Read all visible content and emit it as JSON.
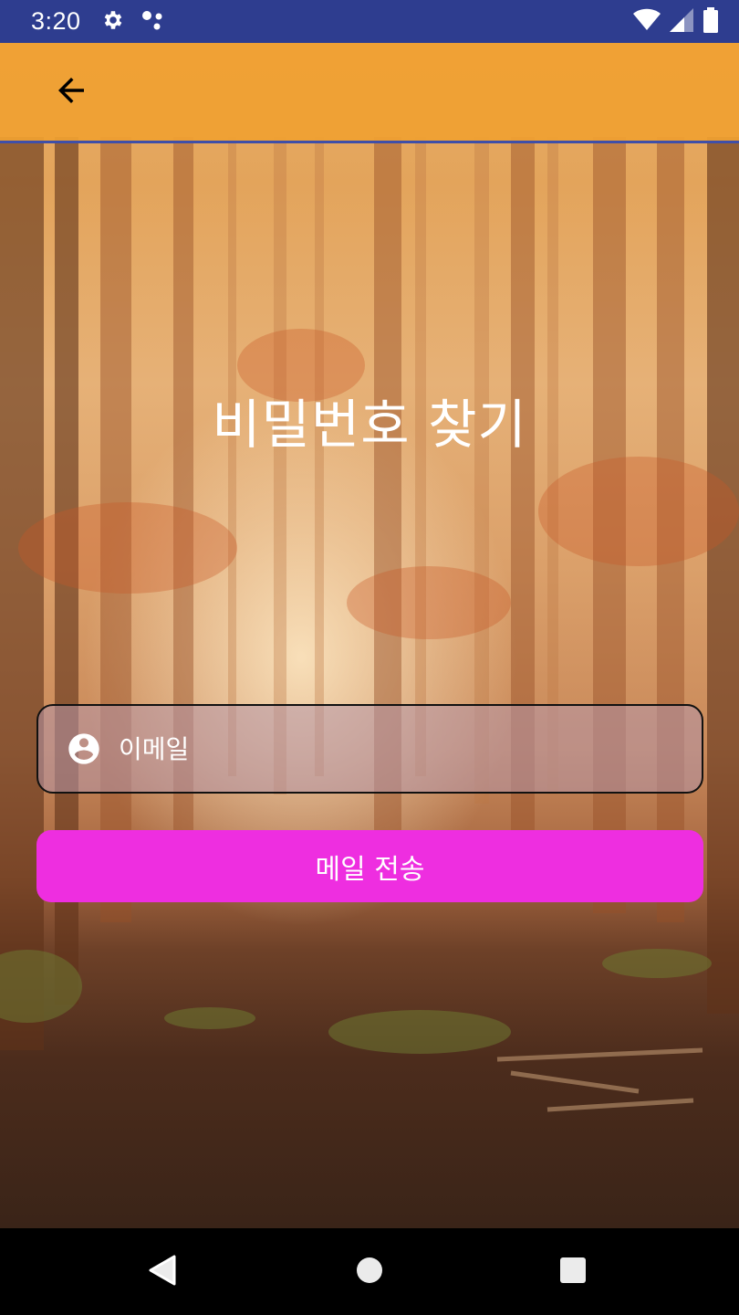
{
  "status_bar": {
    "time": "3:20",
    "icons": [
      "settings-icon",
      "assistant-dots-icon",
      "wifi-icon",
      "signal-icon",
      "battery-icon"
    ]
  },
  "app_bar": {
    "back_icon": "arrow-back-icon",
    "color": "#f0a032"
  },
  "main": {
    "title": "비밀번호 찾기",
    "email_field": {
      "icon": "account-circle-icon",
      "placeholder": "이메일",
      "value": ""
    },
    "send_button": {
      "label": "메일 전송",
      "color": "#ee2ee0"
    }
  },
  "nav_bar": {
    "buttons": [
      "back-triangle-icon",
      "home-circle-icon",
      "recents-square-icon"
    ]
  }
}
